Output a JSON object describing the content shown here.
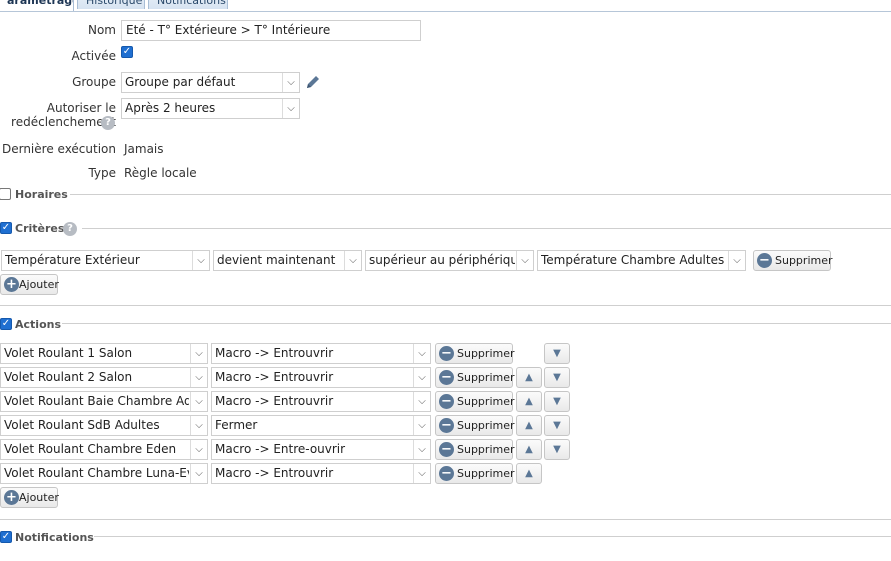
{
  "tabs": [
    "aramétrage",
    "Historique",
    "Notifications"
  ],
  "fields": {
    "nom": {
      "label": "Nom",
      "value": "Eté - T° Extérieure > T° Intérieure"
    },
    "activee": {
      "label": "Activée",
      "checked": true
    },
    "groupe": {
      "label": "Groupe",
      "value": "Groupe par défaut"
    },
    "autoriser": {
      "label_line1": "Autoriser le",
      "label_line2": "redéclenchement",
      "value": "Après 2 heures"
    },
    "derniere": {
      "label": "Dernière exécution",
      "value": "Jamais"
    },
    "type": {
      "label": "Type",
      "value": "Règle locale"
    }
  },
  "sections": {
    "horaires": {
      "title": "Horaires",
      "checked": false
    },
    "criteres": {
      "title": "Critères",
      "checked": true
    },
    "actions": {
      "title": "Actions",
      "checked": true
    },
    "notifications": {
      "title": "Notifications",
      "checked": true
    }
  },
  "criteria": [
    {
      "device": "Température Extérieur",
      "operator": "devient maintenant",
      "comparison": "supérieur au périphérique",
      "target": "Température Chambre Adultes"
    }
  ],
  "actions": [
    {
      "device": "Volet Roulant 1 Salon",
      "command": "Macro -> Entrouvrir",
      "up": false,
      "down": true
    },
    {
      "device": "Volet Roulant 2 Salon",
      "command": "Macro -> Entrouvrir",
      "up": true,
      "down": true
    },
    {
      "device": "Volet Roulant Baie Chambre Adultes",
      "command": "Macro -> Entrouvrir",
      "up": true,
      "down": true
    },
    {
      "device": "Volet Roulant SdB Adultes",
      "command": "Fermer",
      "up": true,
      "down": true
    },
    {
      "device": "Volet Roulant Chambre Eden",
      "command": "Macro -> Entre-ouvrir",
      "up": true,
      "down": true
    },
    {
      "device": "Volet Roulant Chambre Luna-Eve",
      "command": "Macro -> Entrouvrir",
      "up": true,
      "down": false
    }
  ],
  "buttons": {
    "supprimer": "Supprimer",
    "ajouter": "Ajouter"
  },
  "icons": {
    "help": "help-icon",
    "edit": "pencil-icon",
    "remove": "minus-circle-icon",
    "add": "plus-circle-icon",
    "up": "arrow-up-icon",
    "down": "arrow-down-icon"
  },
  "colors": {
    "checkbox": "#1f6fd1",
    "icon": "#5b7796"
  }
}
